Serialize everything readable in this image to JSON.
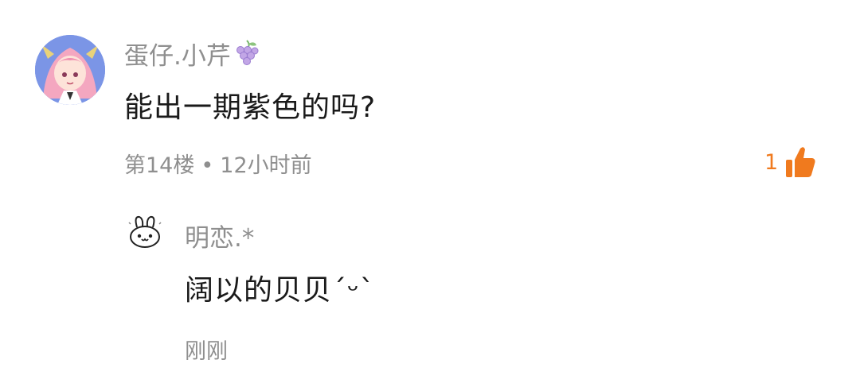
{
  "comment": {
    "username": "蛋仔.小芹",
    "username_icon": "grape-icon",
    "text": "能出一期紫色的吗?",
    "floor": "第14楼",
    "separator": "•",
    "time": "12小时前",
    "like_count": "1",
    "like_icon": "thumbs-up-icon",
    "accent_color": "#f07a1e"
  },
  "reply": {
    "avatar_icon": "bunny-face-icon",
    "username": "明恋.*",
    "text": "阔以的贝贝ˊᵕˋ",
    "time": "刚刚"
  }
}
